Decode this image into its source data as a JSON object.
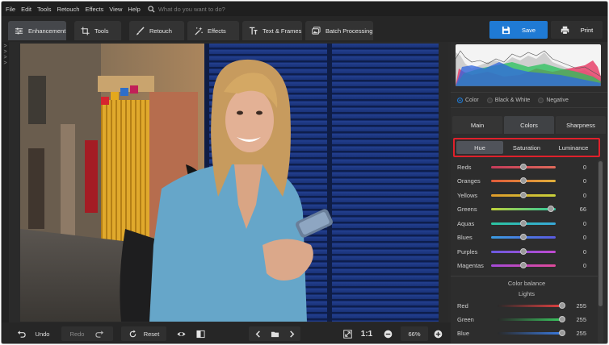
{
  "menu": {
    "items": [
      "File",
      "Edit",
      "Tools",
      "Retouch",
      "Effects",
      "View",
      "Help"
    ],
    "search_placeholder": "What do you want to do?"
  },
  "toolbar": {
    "tabs": [
      "Enhancement",
      "Tools",
      "Retouch",
      "Effects",
      "Text & Frames",
      "Batch Processing"
    ],
    "active_tab": "Enhancement",
    "save_label": "Save",
    "print_label": "Print",
    "accent": "#1f7ad4"
  },
  "left_strip": {
    "glyphs": [
      ">",
      ">",
      ">",
      ">"
    ]
  },
  "bottom": {
    "undo_label": "Undo",
    "redo_label": "Redo",
    "reset_label": "Reset",
    "one_to_one": "1:1",
    "zoom": "66%"
  },
  "panel": {
    "modes": [
      "Color",
      "Black & White",
      "Negative"
    ],
    "selected_mode": "Color",
    "subtabs": [
      "Main",
      "Colors",
      "Sharpness"
    ],
    "active_subtab": "Colors",
    "segments": [
      "Hue",
      "Saturation",
      "Luminance"
    ],
    "active_segment": "Hue",
    "hue_sliders": [
      {
        "label": "Reds",
        "value": "0",
        "level": 0.5
      },
      {
        "label": "Oranges",
        "value": "0",
        "level": 0.5
      },
      {
        "label": "Yellows",
        "value": "0",
        "level": 0.5
      },
      {
        "label": "Greens",
        "value": "66",
        "level": 0.92
      },
      {
        "label": "Aquas",
        "value": "0",
        "level": 0.5
      },
      {
        "label": "Blues",
        "value": "0",
        "level": 0.5
      },
      {
        "label": "Purples",
        "value": "0",
        "level": 0.5
      },
      {
        "label": "Magentas",
        "value": "0",
        "level": 0.5
      }
    ],
    "color_balance_title": "Color balance",
    "lights_title": "Lights",
    "balance_sliders": [
      {
        "label": "Red",
        "value": "255",
        "level": 1.0
      },
      {
        "label": "Green",
        "value": "255",
        "level": 1.0
      },
      {
        "label": "Blue",
        "value": "255",
        "level": 1.0
      }
    ]
  }
}
